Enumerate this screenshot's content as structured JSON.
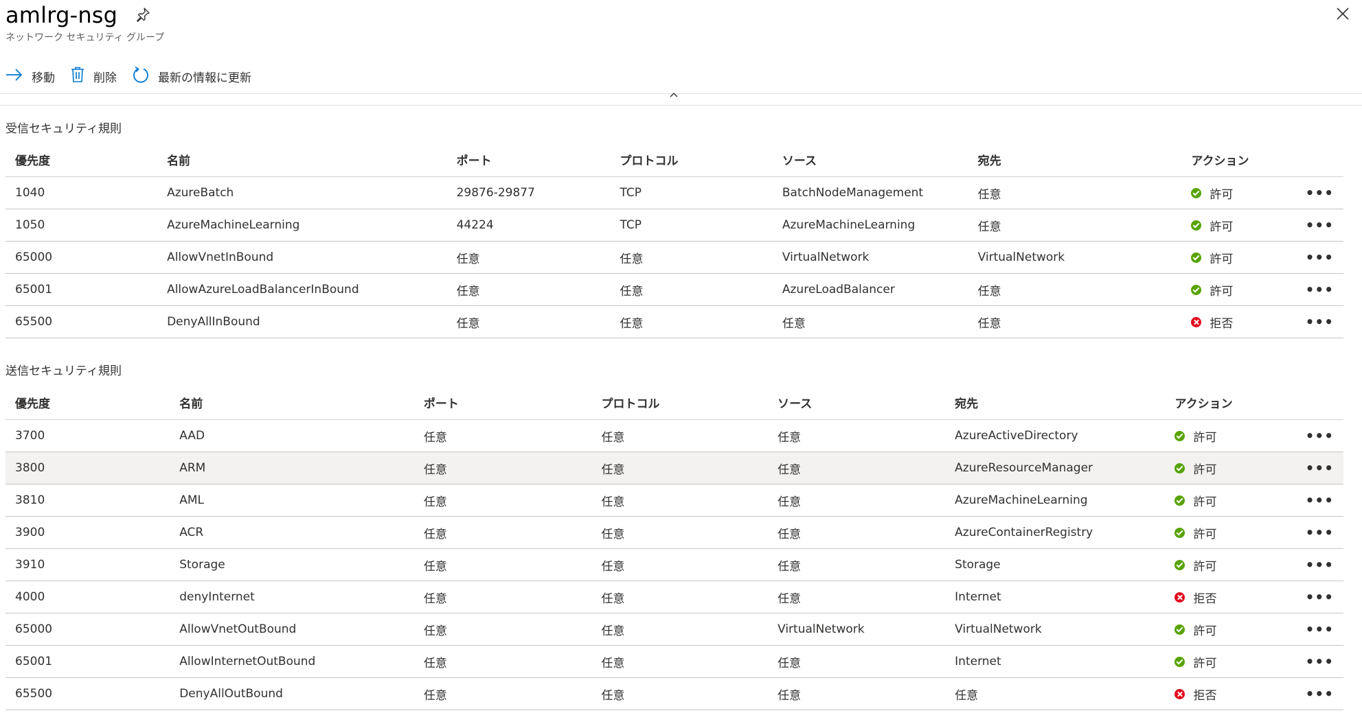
{
  "header": {
    "title": "amlrg-nsg",
    "subtitle": "ネットワーク セキュリティ グループ"
  },
  "toolbar": {
    "move_label": "移動",
    "delete_label": "削除",
    "refresh_label": "最新の情報に更新"
  },
  "inbound": {
    "title": "受信セキュリティ規則",
    "columns": [
      "優先度",
      "名前",
      "ポート",
      "プロトコル",
      "ソース",
      "宛先",
      "アクション"
    ],
    "rows": [
      {
        "priority": "1040",
        "name": "AzureBatch",
        "port": "29876-29877",
        "protocol": "TCP",
        "source": "BatchNodeManagement",
        "dest": "任意",
        "action": "許可",
        "status": "allow"
      },
      {
        "priority": "1050",
        "name": "AzureMachineLearning",
        "port": "44224",
        "protocol": "TCP",
        "source": "AzureMachineLearning",
        "dest": "任意",
        "action": "許可",
        "status": "allow"
      },
      {
        "priority": "65000",
        "name": "AllowVnetInBound",
        "port": "任意",
        "protocol": "任意",
        "source": "VirtualNetwork",
        "dest": "VirtualNetwork",
        "action": "許可",
        "status": "allow"
      },
      {
        "priority": "65001",
        "name": "AllowAzureLoadBalancerInBound",
        "port": "任意",
        "protocol": "任意",
        "source": "AzureLoadBalancer",
        "dest": "任意",
        "action": "許可",
        "status": "allow"
      },
      {
        "priority": "65500",
        "name": "DenyAllInBound",
        "port": "任意",
        "protocol": "任意",
        "source": "任意",
        "dest": "任意",
        "action": "拒否",
        "status": "deny"
      }
    ]
  },
  "outbound": {
    "title": "送信セキュリティ規則",
    "columns": [
      "優先度",
      "名前",
      "ポート",
      "プロトコル",
      "ソース",
      "宛先",
      "アクション"
    ],
    "rows": [
      {
        "priority": "3700",
        "name": "AAD",
        "port": "任意",
        "protocol": "任意",
        "source": "任意",
        "dest": "AzureActiveDirectory",
        "action": "許可",
        "status": "allow"
      },
      {
        "priority": "3800",
        "name": "ARM",
        "port": "任意",
        "protocol": "任意",
        "source": "任意",
        "dest": "AzureResourceManager",
        "action": "許可",
        "status": "allow"
      },
      {
        "priority": "3810",
        "name": "AML",
        "port": "任意",
        "protocol": "任意",
        "source": "任意",
        "dest": "AzureMachineLearning",
        "action": "許可",
        "status": "allow"
      },
      {
        "priority": "3900",
        "name": "ACR",
        "port": "任意",
        "protocol": "任意",
        "source": "任意",
        "dest": "AzureContainerRegistry",
        "action": "許可",
        "status": "allow"
      },
      {
        "priority": "3910",
        "name": "Storage",
        "port": "任意",
        "protocol": "任意",
        "source": "任意",
        "dest": "Storage",
        "action": "許可",
        "status": "allow"
      },
      {
        "priority": "4000",
        "name": "denyInternet",
        "port": "任意",
        "protocol": "任意",
        "source": "任意",
        "dest": "Internet",
        "action": "拒否",
        "status": "deny"
      },
      {
        "priority": "65000",
        "name": "AllowVnetOutBound",
        "port": "任意",
        "protocol": "任意",
        "source": "VirtualNetwork",
        "dest": "VirtualNetwork",
        "action": "許可",
        "status": "allow"
      },
      {
        "priority": "65001",
        "name": "AllowInternetOutBound",
        "port": "任意",
        "protocol": "任意",
        "source": "任意",
        "dest": "Internet",
        "action": "許可",
        "status": "allow"
      },
      {
        "priority": "65500",
        "name": "DenyAllOutBound",
        "port": "任意",
        "protocol": "任意",
        "source": "任意",
        "dest": "任意",
        "action": "拒否",
        "status": "deny"
      }
    ]
  },
  "more_glyph": "•••",
  "colors": {
    "allow": "#57a300",
    "deny": "#e00b1c",
    "accent": "#0078d4",
    "highlight_row": "#f3f2f1"
  },
  "icons": {
    "pin": "pin-icon",
    "close": "close-icon",
    "move": "arrow-right-icon",
    "delete": "trash-icon",
    "refresh": "refresh-icon",
    "collapse": "chevron-up-icon",
    "more": "more-icon"
  }
}
